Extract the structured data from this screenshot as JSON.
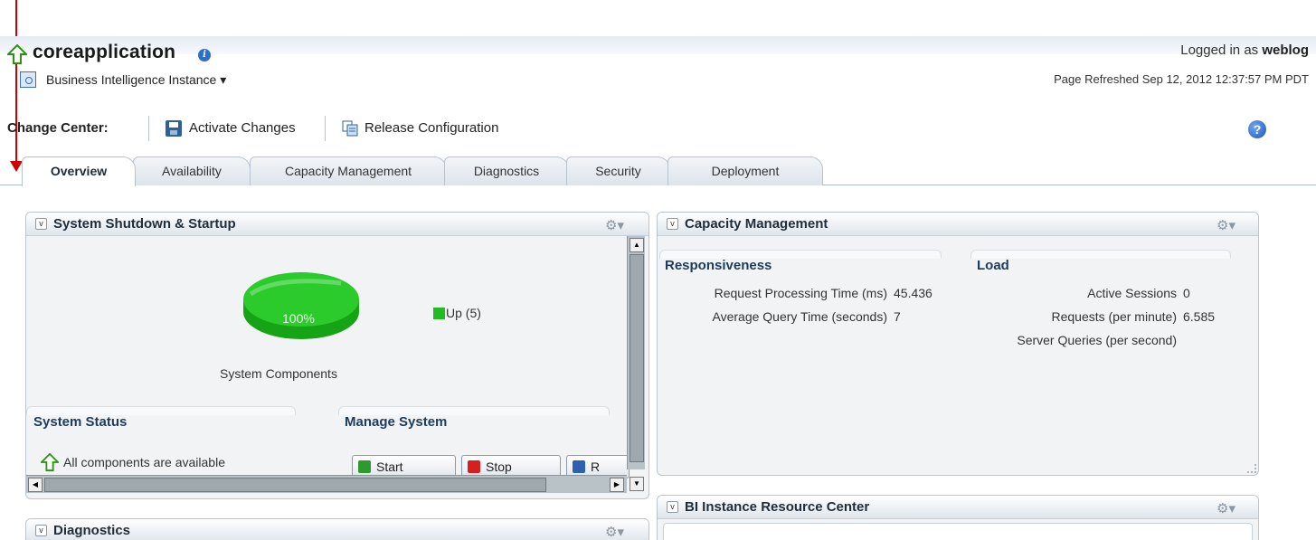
{
  "header": {
    "title": "coreapplication",
    "info_icon": "i",
    "logged_in_prefix": "Logged in as",
    "user": "weblog",
    "instance_menu": "Business Intelligence Instance ▾",
    "page_refreshed": "Page Refreshed Sep 12, 2012 12:37:57 PM PDT"
  },
  "change_center": {
    "label": "Change Center:",
    "activate": "Activate Changes",
    "release": "Release Configuration",
    "help": "?"
  },
  "tabs": [
    {
      "label": "Overview",
      "active": true
    },
    {
      "label": "Availability"
    },
    {
      "label": "Capacity Management"
    },
    {
      "label": "Diagnostics"
    },
    {
      "label": "Security"
    },
    {
      "label": "Deployment"
    }
  ],
  "shutdown_panel": {
    "title": "System Shutdown & Startup",
    "pie_label": "100%",
    "legend_up": "Up (5)",
    "caption": "System Components",
    "status_head": "System Status",
    "status_text": "All components are available",
    "manage_head": "Manage System",
    "start": "Start",
    "stop": "Stop",
    "restart_partial": "R"
  },
  "capacity_panel": {
    "title": "Capacity Management",
    "responsiveness_head": "Responsiveness",
    "load_head": "Load",
    "metrics_left": [
      {
        "label": "Request Processing Time (ms)",
        "value": "45.436"
      },
      {
        "label": "Average Query Time (seconds)",
        "value": "7"
      }
    ],
    "metrics_right": [
      {
        "label": "Active Sessions",
        "value": "0"
      },
      {
        "label": "Requests (per minute)",
        "value": "6.585"
      },
      {
        "label": "Server Queries (per second)",
        "value": ""
      }
    ]
  },
  "resource_panel": {
    "title": "BI Instance Resource Center"
  },
  "diagnostics_panel": {
    "title": "Diagnostics"
  },
  "colors": {
    "status_up": "#22bb22",
    "accent": "#1d3b5c",
    "stop_red": "#d62020"
  }
}
